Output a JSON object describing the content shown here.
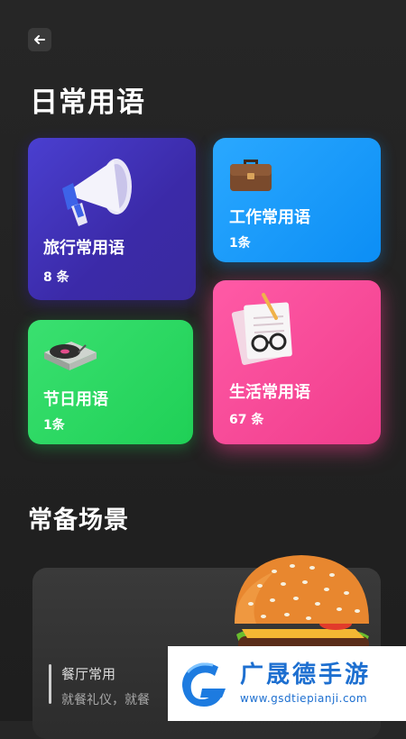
{
  "header": {
    "back_icon": "arrow-left-icon"
  },
  "section_daily": {
    "title": "日常用语"
  },
  "cards": {
    "travel": {
      "title": "旅行常用语",
      "count": "8 条",
      "icon": "megaphone-icon",
      "color": "#4a3fd0"
    },
    "work": {
      "title": "工作常用语",
      "count": "1条",
      "icon": "briefcase-icon",
      "color": "#1a9bfb"
    },
    "holiday": {
      "title": "节日用语",
      "count": "1条",
      "icon": "turntable-icon",
      "color": "#2ad862"
    },
    "life": {
      "title": "生活常用语",
      "count": "67 条",
      "icon": "notes-glasses-icon",
      "color": "#f8479a"
    }
  },
  "section_scenes": {
    "title": "常备场景"
  },
  "scene_card": {
    "title": "餐厅常用",
    "subtitle": "就餐礼仪，就餐",
    "image": "burger-illustration"
  },
  "watermark": {
    "title": "广晟德手游",
    "url": "www.gsdtiepianji.com",
    "logo": "g-logo"
  }
}
